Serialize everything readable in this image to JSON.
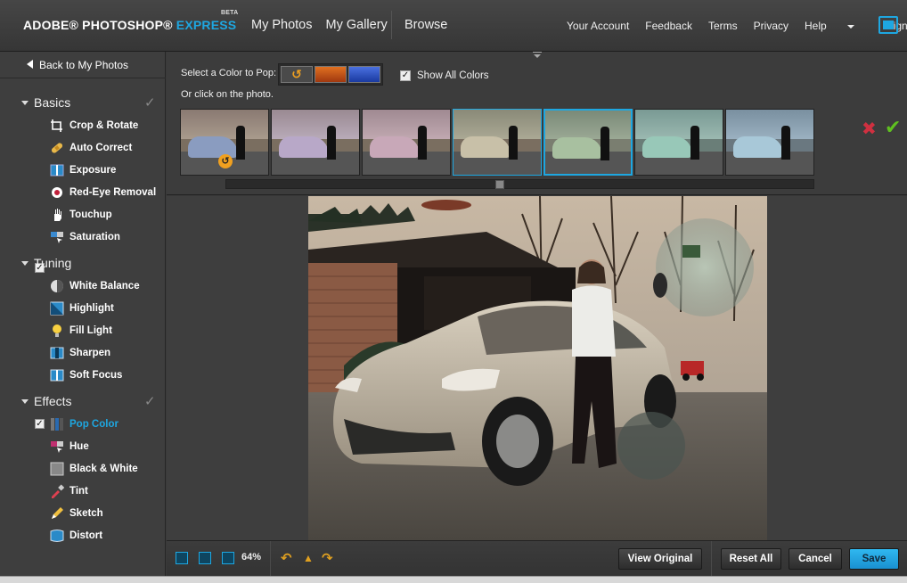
{
  "header": {
    "brand_main": "ADOBE® PHOTOSHOP®",
    "brand_express": "EXPRESS",
    "brand_beta": "BETA",
    "nav": [
      "My Photos",
      "My Gallery"
    ],
    "browse": "Browse",
    "user_links": {
      "account": "Your Account",
      "feedback": "Feedback",
      "terms": "Terms",
      "privacy": "Privacy",
      "help": "Help",
      "signout": "Sign Out"
    }
  },
  "sidebar": {
    "back_label": "Back to My Photos",
    "sections": {
      "basics": "Basics",
      "tuning": "Tuning",
      "effects": "Effects"
    },
    "tools": {
      "crop": "Crop & Rotate",
      "autocorrect": "Auto Correct",
      "exposure": "Exposure",
      "redeye": "Red-Eye Removal",
      "touchup": "Touchup",
      "saturation": "Saturation",
      "whitebalance": "White Balance",
      "highlight": "Highlight",
      "filllight": "Fill Light",
      "sharpen": "Sharpen",
      "softfocus": "Soft Focus",
      "popcolor": "Pop Color",
      "hue": "Hue",
      "blackwhite": "Black & White",
      "tint": "Tint",
      "sketch": "Sketch",
      "distort": "Distort"
    }
  },
  "panel": {
    "pop_label": "Select a Color to Pop:",
    "click_label": "Or click on the photo.",
    "show_all_label": "Show All Colors",
    "show_all_checked": true
  },
  "bottom": {
    "zoom": "64%",
    "view_original": "View Original",
    "reset_all": "Reset All",
    "cancel": "Cancel",
    "save": "Save"
  },
  "colors": {
    "accent": "#1ea7e1",
    "reject": "#d03040",
    "accept": "#5fc020"
  }
}
